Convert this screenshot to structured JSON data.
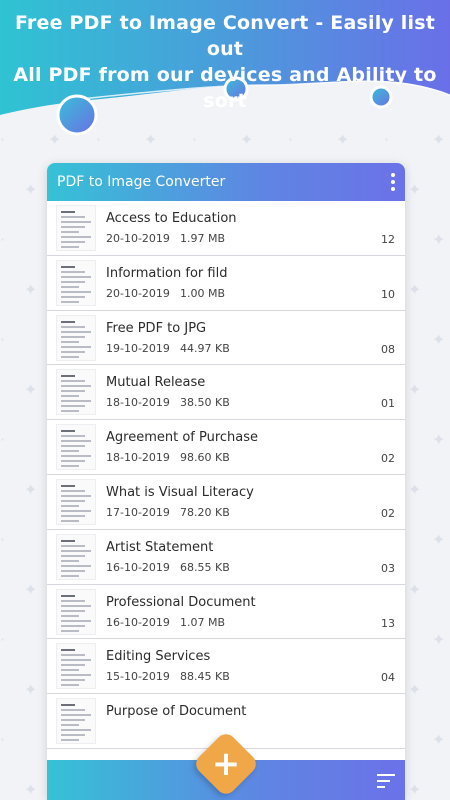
{
  "headline": {
    "line1": "Free PDF to Image Convert - Easily list out",
    "line2": "All PDF from our devices and Ability to sort"
  },
  "app": {
    "title": "PDF to Image Converter"
  },
  "colors": {
    "gradient_start": "#35c2d6",
    "gradient_end": "#6b72e8",
    "fab": "#f0a748"
  },
  "icons": {
    "menu": "more-vert-icon",
    "add": "plus-icon",
    "sort": "sort-icon"
  },
  "files": [
    {
      "name": "Access to Education",
      "date": "20-10-2019",
      "size": "1.97 MB",
      "pages": "12"
    },
    {
      "name": "Information for fild",
      "date": "20-10-2019",
      "size": "1.00 MB",
      "pages": "10"
    },
    {
      "name": "Free PDF to JPG",
      "date": "19-10-2019",
      "size": "44.97 KB",
      "pages": "08"
    },
    {
      "name": "Mutual Release",
      "date": "18-10-2019",
      "size": "38.50 KB",
      "pages": "01"
    },
    {
      "name": "Agreement of Purchase",
      "date": "18-10-2019",
      "size": "98.60 KB",
      "pages": "02"
    },
    {
      "name": "What is Visual Literacy",
      "date": "17-10-2019",
      "size": "78.20 KB",
      "pages": "02"
    },
    {
      "name": "Artist Statement",
      "date": "16-10-2019",
      "size": "68.55 KB",
      "pages": "03"
    },
    {
      "name": "Professional Document",
      "date": "16-10-2019",
      "size": "1.07 MB",
      "pages": "13"
    },
    {
      "name": "Editing Services",
      "date": "15-10-2019",
      "size": "88.45 KB",
      "pages": "04"
    },
    {
      "name": "Purpose of Document",
      "date": "",
      "size": "",
      "pages": ""
    }
  ]
}
